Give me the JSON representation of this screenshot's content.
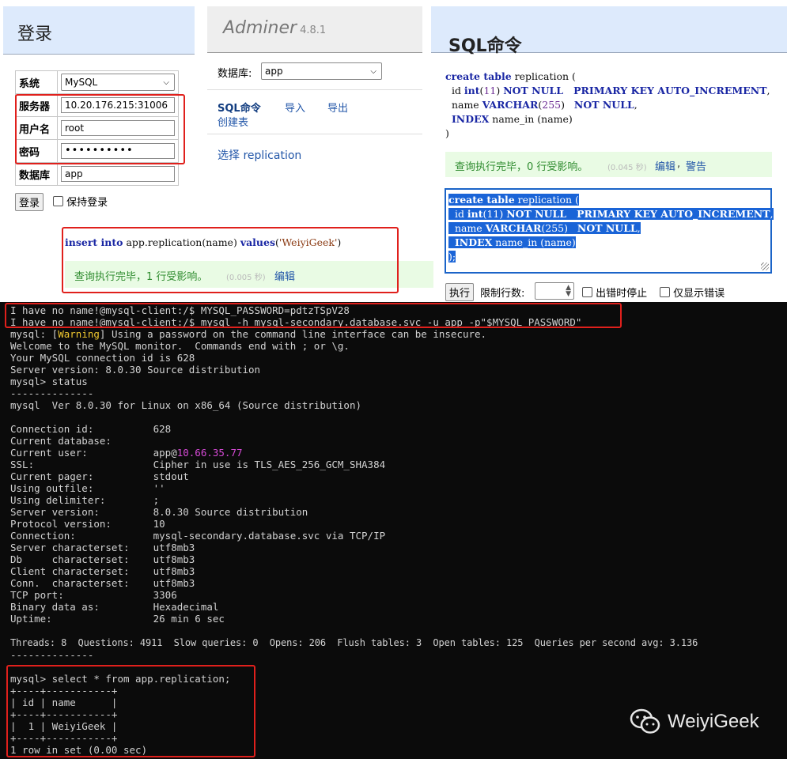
{
  "login": {
    "title": "登录",
    "system_label": "系统",
    "system_value": "MySQL",
    "server_label": "服务器",
    "server_value": "10.20.176.215:31006",
    "user_label": "用户名",
    "user_value": "root",
    "password_label": "密码",
    "password_value": "••••••••••",
    "db_label": "数据库",
    "db_value": "app",
    "login_button": "登录",
    "remember_label": "保持登录"
  },
  "adminer": {
    "name": "Adminer",
    "version": "4.8.1",
    "db_label": "数据库:",
    "db_value": "app",
    "links": [
      "SQL命令",
      "导入",
      "导出",
      "创建表"
    ],
    "select_link": "选择 replication"
  },
  "insert_query": {
    "kw1": "insert into",
    "text1": " app.replication(name) ",
    "kw2": "values",
    "open": "(",
    "string": "'WeiyiGeek'",
    "close": ")",
    "result": "查询执行完毕，1 行受影响。",
    "time": "(0.005 秒)",
    "edit": "编辑"
  },
  "sql_panel": {
    "title": "SQL命令",
    "result": "查询执行完毕，0 行受影响。",
    "time": "(0.045 秒)",
    "edit": "编辑",
    "sep": ",",
    "warning": "警告",
    "execute_button": "执行",
    "limit_label": "限制行数:",
    "stop_on_error": "出错时停止",
    "only_errors": "仅显示错误"
  },
  "sql_code": {
    "l1_kw": "create table",
    "l1_t": " replication (",
    "l2_a": "  id ",
    "l2_kw1": "int",
    "l2_b": "(",
    "l2_num": "11",
    "l2_c": ") ",
    "l2_kw2": "NOT NULL   PRIMARY KEY AUTO_INCREMENT",
    "l2_d": ",",
    "l3_a": "  name ",
    "l3_kw1": "VARCHAR",
    "l3_b": "(",
    "l3_num": "255",
    "l3_c": ")   ",
    "l3_kw2": "NOT NULL",
    "l3_d": ",",
    "l4_a": "  ",
    "l4_kw": "INDEX",
    "l4_b": " name_in (name)",
    "l5": ")"
  },
  "terminal": {
    "l01": "I have no name!@mysql-client:/$ MYSQL_PASSWORD=pdtzTSpV28",
    "l02": "I have no name!@mysql-client:/$ mysql -h mysql-secondary.database.svc -u app -p\"$MYSQL_PASSWORD\"",
    "l03a": "mysql: [",
    "l03b": "Warning",
    "l03c": "] Using a password on the command line interface can be insecure.",
    "l04": "Welcome to the MySQL monitor.  Commands end with ; or \\g.",
    "l05": "Your MySQL connection id is 628",
    "l06": "Server version: 8.0.30 Source distribution",
    "l07": "mysql> status",
    "l08": "--------------",
    "l09": "mysql  Ver 8.0.30 for Linux on x86_64 (Source distribution)",
    "l11": "Connection id:          628",
    "l12": "Current database:",
    "l13a": "Current user:           app@",
    "l13b": "10.66.35.77",
    "l14": "SSL:                    Cipher in use is TLS_AES_256_GCM_SHA384",
    "l15": "Current pager:          stdout",
    "l16": "Using outfile:          ''",
    "l17": "Using delimiter:        ;",
    "l18": "Server version:         8.0.30 Source distribution",
    "l19": "Protocol version:       10",
    "l20": "Connection:             mysql-secondary.database.svc via TCP/IP",
    "l21": "Server characterset:    utf8mb3",
    "l22": "Db     characterset:    utf8mb3",
    "l23": "Client characterset:    utf8mb3",
    "l24": "Conn.  characterset:    utf8mb3",
    "l25": "TCP port:               3306",
    "l26": "Binary data as:         Hexadecimal",
    "l27": "Uptime:                 26 min 6 sec",
    "l29": "Threads: 8  Questions: 4911  Slow queries: 0  Opens: 206  Flush tables: 3  Open tables: 125  Queries per second avg: 3.136",
    "l30": "--------------",
    "l32": "mysql> select * from app.replication;",
    "l33": "+----+-----------+",
    "l34": "| id | name      |",
    "l35": "+----+-----------+",
    "l36": "|  1 | WeiyiGeek |",
    "l37": "+----+-----------+",
    "l38": "1 row in set (0.00 sec)"
  },
  "watermark": "WeiyiGeek"
}
